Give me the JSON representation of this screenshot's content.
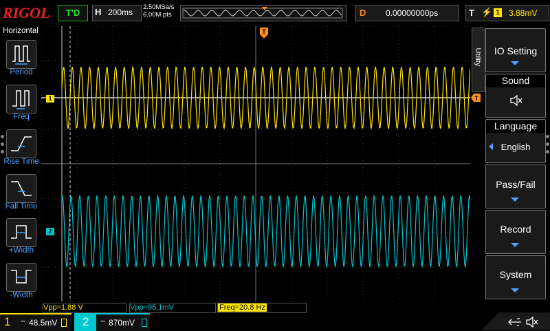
{
  "brand": "RIGOL",
  "run_state": "T'D",
  "horizontal": {
    "label": "H",
    "timebase": "200ms",
    "sample_rate": "2.50MSa/s",
    "memory_depth": "6.00M pts"
  },
  "delay": {
    "label": "D",
    "value": "0.00000000ps"
  },
  "trigger": {
    "label": "T",
    "edge_icon": "rising-edge-icon",
    "source": "1",
    "level": "3.88mV"
  },
  "left_menu": {
    "title": "Horizontal",
    "items": [
      {
        "label": "Period",
        "icon": "period-icon"
      },
      {
        "label": "Freq",
        "icon": "freq-icon"
      },
      {
        "label": "Rise Time",
        "icon": "rise-time-icon"
      },
      {
        "label": "Fall Time",
        "icon": "fall-time-icon"
      },
      {
        "label": "+Width",
        "icon": "positive-width-icon"
      },
      {
        "label": "-Width",
        "icon": "negative-width-icon"
      }
    ]
  },
  "right_menu": {
    "tab": "Utility",
    "items": [
      {
        "label": "IO Setting"
      },
      {
        "label": "Sound",
        "value_icon": "speaker-mute-icon"
      },
      {
        "label": "Language",
        "value": "English"
      },
      {
        "label": "Pass/Fail"
      },
      {
        "label": "Record"
      },
      {
        "label": "System"
      }
    ]
  },
  "channel_markers": {
    "ch1": "1",
    "ch2": "2"
  },
  "measurements": [
    {
      "text": "Vpp=1.88 V",
      "color": "#ffe600"
    },
    {
      "text": "Vpp=95.1mV",
      "color": "#00c8d0"
    },
    {
      "text": "Freq=20.8 Hz",
      "color": "#ffe600"
    }
  ],
  "channels": [
    {
      "number": "1",
      "coupling": "~",
      "scale": "48.5mV",
      "color": "#ffe600"
    },
    {
      "number": "2",
      "coupling": "~",
      "scale": "870mV",
      "color": "#00c8d0"
    }
  ],
  "colors": {
    "ch1": "#ffe600",
    "ch2": "#00c8d0",
    "accent": "#4da3ff",
    "trigger": "#ff8c1a",
    "brand": "#e8201c"
  }
}
